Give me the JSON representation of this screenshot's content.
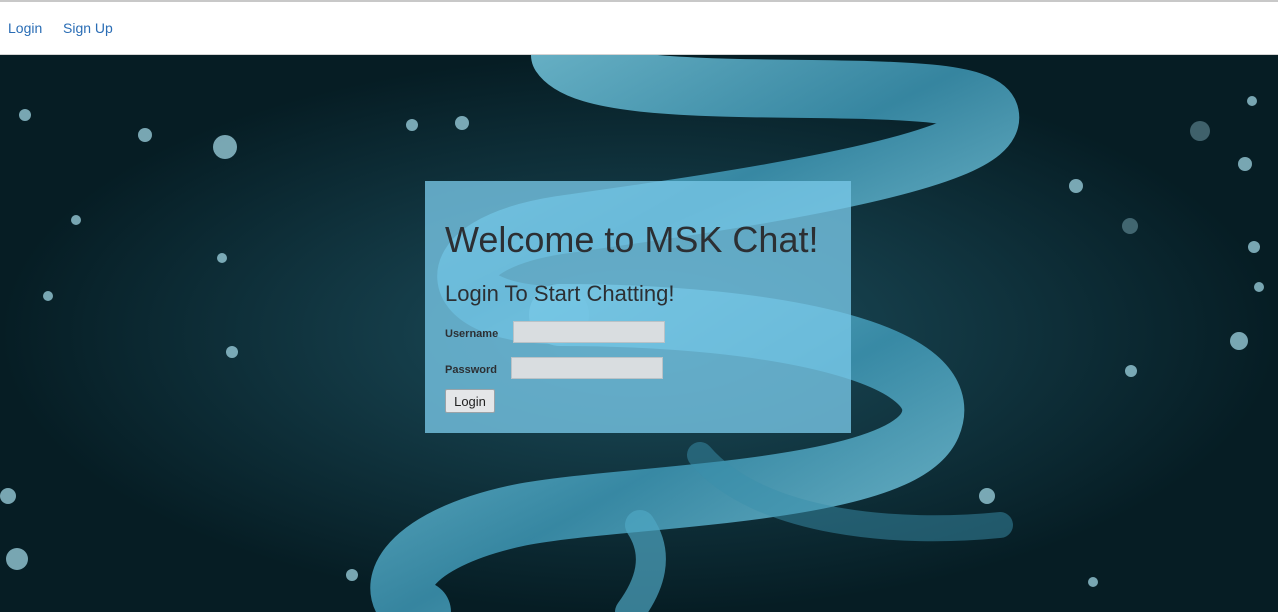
{
  "nav": {
    "items": [
      {
        "label": "Login"
      },
      {
        "label": "Sign Up"
      }
    ]
  },
  "colors": {
    "nav_link": "#2a6db5",
    "hero_background": "#061d24",
    "card_background": "#78c8e8",
    "helix": "#5bb6d2"
  },
  "login_card": {
    "title": "Welcome to MSK Chat!",
    "subtitle": "Login To Start Chatting!",
    "username_label": "Username",
    "username_value": "",
    "password_label": "Password",
    "password_value": "",
    "submit_label": "Login"
  }
}
